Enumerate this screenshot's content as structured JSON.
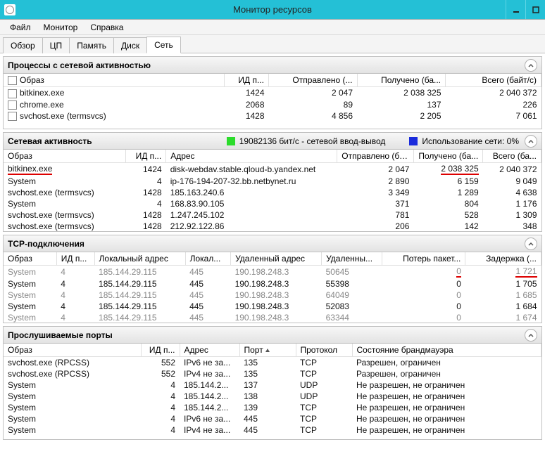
{
  "window": {
    "title": "Монитор ресурсов"
  },
  "menu": {
    "file": "Файл",
    "monitor": "Монитор",
    "help": "Справка"
  },
  "tabs": {
    "overview": "Обзор",
    "cpu": "ЦП",
    "memory": "Память",
    "disk": "Диск",
    "network": "Сеть"
  },
  "sections": {
    "processes": {
      "title": "Процессы с сетевой активностью",
      "columns": {
        "image": "Образ",
        "pid": "ИД п...",
        "sent": "Отправлено (...",
        "recv": "Получено (ба...",
        "total": "Всего (байт/с)"
      },
      "rows": [
        {
          "image": "bitkinex.exe",
          "pid": "1424",
          "sent": "2 047",
          "recv": "2 038 325",
          "total": "2 040 372"
        },
        {
          "image": "chrome.exe",
          "pid": "2068",
          "sent": "89",
          "recv": "137",
          "total": "226"
        },
        {
          "image": "svchost.exe (termsvcs)",
          "pid": "1428",
          "sent": "4 856",
          "recv": "2 205",
          "total": "7 061"
        }
      ]
    },
    "activity": {
      "title": "Сетевая активность",
      "legend": {
        "io_color": "#2bdc2b",
        "io_text": "19082136 бит/с - сетевой ввод-вывод",
        "use_color": "#1a2bdc",
        "use_text": "Использование сети: 0%"
      },
      "columns": {
        "image": "Образ",
        "pid": "ИД п...",
        "addr": "Адрес",
        "sent": "Отправлено (ба...",
        "recv": "Получено (ба...",
        "total": "Всего (ба..."
      },
      "rows": [
        {
          "image": "bitkinex.exe",
          "pid": "1424",
          "addr": "disk-webdav.stable.qloud-b.yandex.net",
          "sent": "2 047",
          "recv": "2 038 325",
          "total": "2 040 372",
          "hl": [
            "image",
            "recv"
          ]
        },
        {
          "image": "System",
          "pid": "4",
          "addr": "ip-176-194-207-32.bb.netbynet.ru",
          "sent": "2 890",
          "recv": "6 159",
          "total": "9 049"
        },
        {
          "image": "svchost.exe (termsvcs)",
          "pid": "1428",
          "addr": "185.163.240.6",
          "sent": "3 349",
          "recv": "1 289",
          "total": "4 638"
        },
        {
          "image": "System",
          "pid": "4",
          "addr": "168.83.90.105",
          "sent": "371",
          "recv": "804",
          "total": "1 176"
        },
        {
          "image": "svchost.exe (termsvcs)",
          "pid": "1428",
          "addr": "1.247.245.102",
          "sent": "781",
          "recv": "528",
          "total": "1 309"
        },
        {
          "image": "svchost.exe (termsvcs)",
          "pid": "1428",
          "addr": "212.92.122.86",
          "sent": "206",
          "recv": "142",
          "total": "348"
        }
      ]
    },
    "tcp": {
      "title": "TCP-подключения",
      "columns": {
        "image": "Образ",
        "pid": "ИД п...",
        "laddr": "Локальный адрес",
        "lport": "Локал...",
        "raddr": "Удаленный адрес",
        "rport": "Удаленны...",
        "loss": "Потерь пакет...",
        "lat": "Задержка (..."
      },
      "rows": [
        {
          "image": "System",
          "pid": "4",
          "laddr": "185.144.29.115",
          "lport": "445",
          "raddr": "190.198.248.3",
          "rport": "50645",
          "loss": "0",
          "lat": "1 721",
          "muted": true,
          "hl": [
            "loss",
            "lat"
          ]
        },
        {
          "image": "System",
          "pid": "4",
          "laddr": "185.144.29.115",
          "lport": "445",
          "raddr": "190.198.248.3",
          "rport": "55398",
          "loss": "0",
          "lat": "1 705"
        },
        {
          "image": "System",
          "pid": "4",
          "laddr": "185.144.29.115",
          "lport": "445",
          "raddr": "190.198.248.3",
          "rport": "64049",
          "loss": "0",
          "lat": "1 685",
          "muted": true
        },
        {
          "image": "System",
          "pid": "4",
          "laddr": "185.144.29.115",
          "lport": "445",
          "raddr": "190.198.248.3",
          "rport": "52083",
          "loss": "0",
          "lat": "1 684"
        },
        {
          "image": "System",
          "pid": "4",
          "laddr": "185.144.29.115",
          "lport": "445",
          "raddr": "190.198.248.3",
          "rport": "63344",
          "loss": "0",
          "lat": "1 674",
          "muted": true
        }
      ]
    },
    "ports": {
      "title": "Прослушиваемые порты",
      "columns": {
        "image": "Образ",
        "pid": "ИД п...",
        "addr": "Адрес",
        "port": "Порт",
        "proto": "Протокол",
        "fw": "Состояние брандмауэра"
      },
      "rows": [
        {
          "image": "svchost.exe (RPCSS)",
          "pid": "552",
          "addr": "IPv6 не за...",
          "port": "135",
          "proto": "TCP",
          "fw": "Разрешен, ограничен"
        },
        {
          "image": "svchost.exe (RPCSS)",
          "pid": "552",
          "addr": "IPv4 не за...",
          "port": "135",
          "proto": "TCP",
          "fw": "Разрешен, ограничен"
        },
        {
          "image": "System",
          "pid": "4",
          "addr": "185.144.2...",
          "port": "137",
          "proto": "UDP",
          "fw": "Не разрешен, не ограничен"
        },
        {
          "image": "System",
          "pid": "4",
          "addr": "185.144.2...",
          "port": "138",
          "proto": "UDP",
          "fw": "Не разрешен, не ограничен"
        },
        {
          "image": "System",
          "pid": "4",
          "addr": "185.144.2...",
          "port": "139",
          "proto": "TCP",
          "fw": "Не разрешен, не ограничен"
        },
        {
          "image": "System",
          "pid": "4",
          "addr": "IPv6 не за...",
          "port": "445",
          "proto": "TCP",
          "fw": "Не разрешен, не ограничен"
        },
        {
          "image": "System",
          "pid": "4",
          "addr": "IPv4 не за...",
          "port": "445",
          "proto": "TCP",
          "fw": "Не разрешен, не ограничен"
        }
      ]
    }
  }
}
